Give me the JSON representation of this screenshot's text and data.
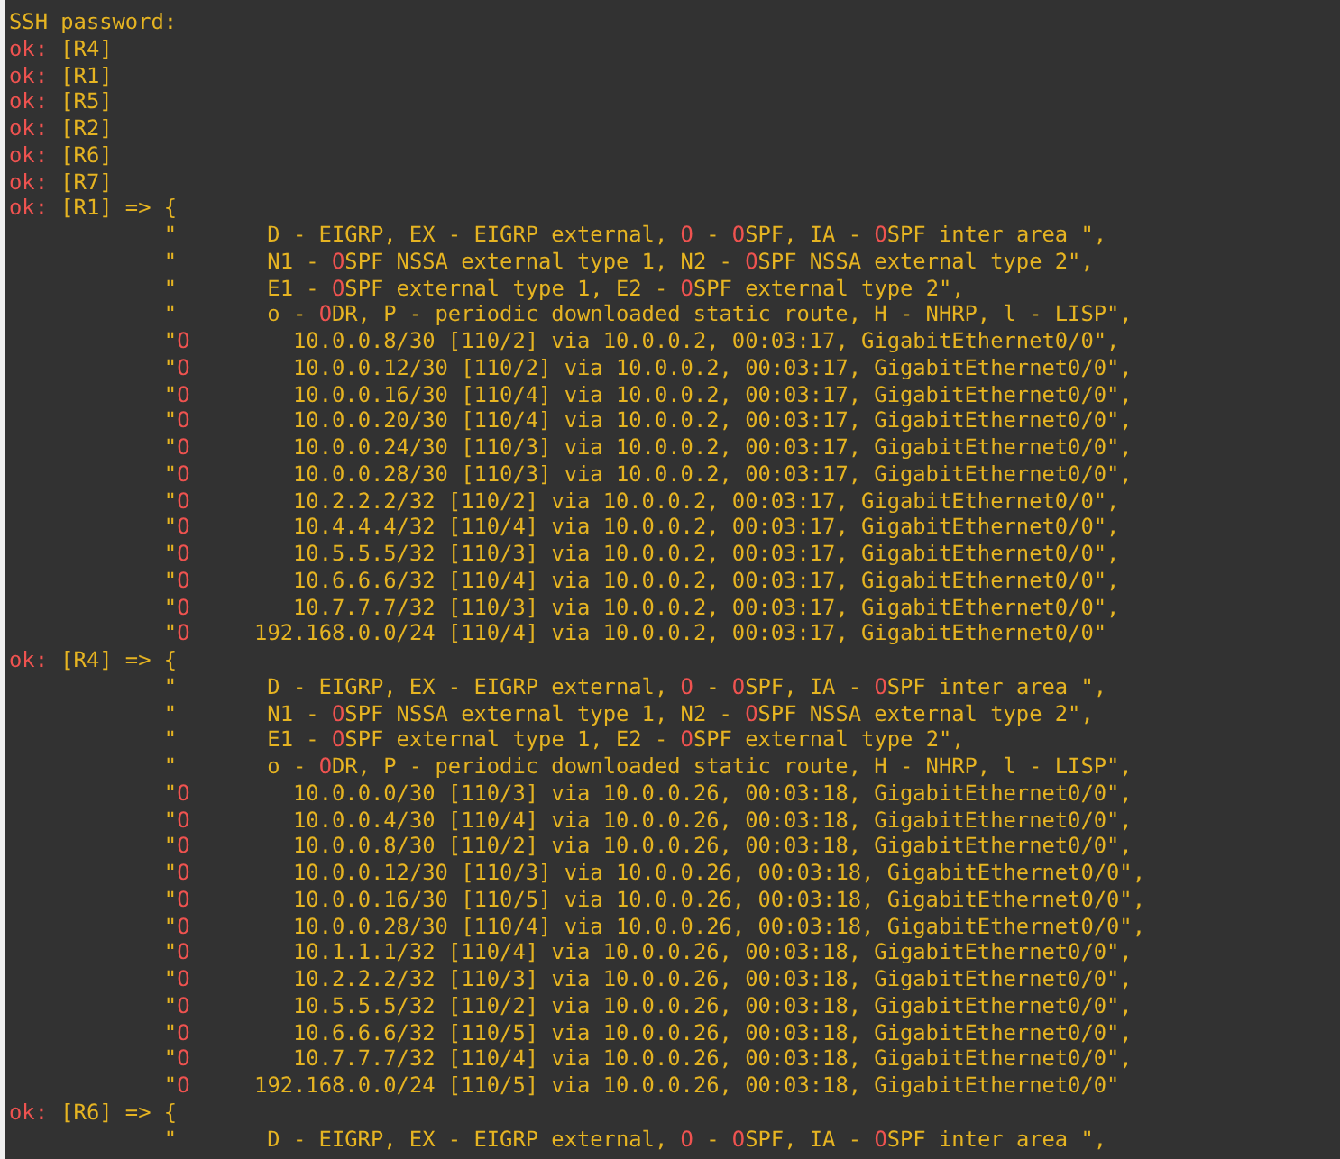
{
  "terminal": {
    "lines": [
      {
        "segments": [
          {
            "text": "SSH password:",
            "kind": "plain"
          }
        ]
      },
      {
        "segments": [
          {
            "text": "ok:",
            "kind": "highlight"
          },
          {
            "text": " [R4]",
            "kind": "plain"
          }
        ]
      },
      {
        "segments": [
          {
            "text": "ok:",
            "kind": "highlight"
          },
          {
            "text": " [R1]",
            "kind": "plain"
          }
        ]
      },
      {
        "segments": [
          {
            "text": "ok:",
            "kind": "highlight"
          },
          {
            "text": " [R5]",
            "kind": "plain"
          }
        ]
      },
      {
        "segments": [
          {
            "text": "ok:",
            "kind": "highlight"
          },
          {
            "text": " [R2]",
            "kind": "plain"
          }
        ]
      },
      {
        "segments": [
          {
            "text": "ok:",
            "kind": "highlight"
          },
          {
            "text": " [R6]",
            "kind": "plain"
          }
        ]
      },
      {
        "segments": [
          {
            "text": "ok:",
            "kind": "highlight"
          },
          {
            "text": " [R7]",
            "kind": "plain"
          }
        ]
      },
      {
        "segments": [
          {
            "text": "ok:",
            "kind": "highlight"
          },
          {
            "text": " [R1] => {",
            "kind": "plain"
          }
        ]
      },
      {
        "segments": [
          {
            "text": "            \"       D - EIGRP, EX - EIGRP external, ",
            "kind": "plain"
          },
          {
            "text": "O",
            "kind": "highlight"
          },
          {
            "text": " - ",
            "kind": "plain"
          },
          {
            "text": "O",
            "kind": "highlight"
          },
          {
            "text": "SPF, IA - ",
            "kind": "plain"
          },
          {
            "text": "O",
            "kind": "highlight"
          },
          {
            "text": "SPF inter area \",",
            "kind": "plain"
          }
        ]
      },
      {
        "segments": [
          {
            "text": "            \"       N1 - ",
            "kind": "plain"
          },
          {
            "text": "O",
            "kind": "highlight"
          },
          {
            "text": "SPF NSSA external type 1, N2 - ",
            "kind": "plain"
          },
          {
            "text": "O",
            "kind": "highlight"
          },
          {
            "text": "SPF NSSA external type 2\",",
            "kind": "plain"
          }
        ]
      },
      {
        "segments": [
          {
            "text": "            \"       E1 - ",
            "kind": "plain"
          },
          {
            "text": "O",
            "kind": "highlight"
          },
          {
            "text": "SPF external type 1, E2 - ",
            "kind": "plain"
          },
          {
            "text": "O",
            "kind": "highlight"
          },
          {
            "text": "SPF external type 2\",",
            "kind": "plain"
          }
        ]
      },
      {
        "segments": [
          {
            "text": "            \"       o - ",
            "kind": "plain"
          },
          {
            "text": "O",
            "kind": "highlight"
          },
          {
            "text": "DR, P - periodic downloaded static route, H - NHRP, l - LISP\",",
            "kind": "plain"
          }
        ]
      },
      {
        "segments": [
          {
            "text": "            \"",
            "kind": "plain"
          },
          {
            "text": "O",
            "kind": "highlight"
          },
          {
            "text": "        10.0.0.8/30 [110/2] via 10.0.0.2, 00:03:17, GigabitEthernet0/0\",",
            "kind": "plain"
          }
        ]
      },
      {
        "segments": [
          {
            "text": "            \"",
            "kind": "plain"
          },
          {
            "text": "O",
            "kind": "highlight"
          },
          {
            "text": "        10.0.0.12/30 [110/2] via 10.0.0.2, 00:03:17, GigabitEthernet0/0\",",
            "kind": "plain"
          }
        ]
      },
      {
        "segments": [
          {
            "text": "            \"",
            "kind": "plain"
          },
          {
            "text": "O",
            "kind": "highlight"
          },
          {
            "text": "        10.0.0.16/30 [110/4] via 10.0.0.2, 00:03:17, GigabitEthernet0/0\",",
            "kind": "plain"
          }
        ]
      },
      {
        "segments": [
          {
            "text": "            \"",
            "kind": "plain"
          },
          {
            "text": "O",
            "kind": "highlight"
          },
          {
            "text": "        10.0.0.20/30 [110/4] via 10.0.0.2, 00:03:17, GigabitEthernet0/0\",",
            "kind": "plain"
          }
        ]
      },
      {
        "segments": [
          {
            "text": "            \"",
            "kind": "plain"
          },
          {
            "text": "O",
            "kind": "highlight"
          },
          {
            "text": "        10.0.0.24/30 [110/3] via 10.0.0.2, 00:03:17, GigabitEthernet0/0\",",
            "kind": "plain"
          }
        ]
      },
      {
        "segments": [
          {
            "text": "            \"",
            "kind": "plain"
          },
          {
            "text": "O",
            "kind": "highlight"
          },
          {
            "text": "        10.0.0.28/30 [110/3] via 10.0.0.2, 00:03:17, GigabitEthernet0/0\",",
            "kind": "plain"
          }
        ]
      },
      {
        "segments": [
          {
            "text": "            \"",
            "kind": "plain"
          },
          {
            "text": "O",
            "kind": "highlight"
          },
          {
            "text": "        10.2.2.2/32 [110/2] via 10.0.0.2, 00:03:17, GigabitEthernet0/0\",",
            "kind": "plain"
          }
        ]
      },
      {
        "segments": [
          {
            "text": "            \"",
            "kind": "plain"
          },
          {
            "text": "O",
            "kind": "highlight"
          },
          {
            "text": "        10.4.4.4/32 [110/4] via 10.0.0.2, 00:03:17, GigabitEthernet0/0\",",
            "kind": "plain"
          }
        ]
      },
      {
        "segments": [
          {
            "text": "            \"",
            "kind": "plain"
          },
          {
            "text": "O",
            "kind": "highlight"
          },
          {
            "text": "        10.5.5.5/32 [110/3] via 10.0.0.2, 00:03:17, GigabitEthernet0/0\",",
            "kind": "plain"
          }
        ]
      },
      {
        "segments": [
          {
            "text": "            \"",
            "kind": "plain"
          },
          {
            "text": "O",
            "kind": "highlight"
          },
          {
            "text": "        10.6.6.6/32 [110/4] via 10.0.0.2, 00:03:17, GigabitEthernet0/0\",",
            "kind": "plain"
          }
        ]
      },
      {
        "segments": [
          {
            "text": "            \"",
            "kind": "plain"
          },
          {
            "text": "O",
            "kind": "highlight"
          },
          {
            "text": "        10.7.7.7/32 [110/3] via 10.0.0.2, 00:03:17, GigabitEthernet0/0\",",
            "kind": "plain"
          }
        ]
      },
      {
        "segments": [
          {
            "text": "            \"",
            "kind": "plain"
          },
          {
            "text": "O",
            "kind": "highlight"
          },
          {
            "text": "     192.168.0.0/24 [110/4] via 10.0.0.2, 00:03:17, GigabitEthernet0/0\"",
            "kind": "plain"
          }
        ]
      },
      {
        "segments": [
          {
            "text": "ok:",
            "kind": "highlight"
          },
          {
            "text": " [R4] => {",
            "kind": "plain"
          }
        ]
      },
      {
        "segments": [
          {
            "text": "            \"       D - EIGRP, EX - EIGRP external, ",
            "kind": "plain"
          },
          {
            "text": "O",
            "kind": "highlight"
          },
          {
            "text": " - ",
            "kind": "plain"
          },
          {
            "text": "O",
            "kind": "highlight"
          },
          {
            "text": "SPF, IA - ",
            "kind": "plain"
          },
          {
            "text": "O",
            "kind": "highlight"
          },
          {
            "text": "SPF inter area \",",
            "kind": "plain"
          }
        ]
      },
      {
        "segments": [
          {
            "text": "            \"       N1 - ",
            "kind": "plain"
          },
          {
            "text": "O",
            "kind": "highlight"
          },
          {
            "text": "SPF NSSA external type 1, N2 - ",
            "kind": "plain"
          },
          {
            "text": "O",
            "kind": "highlight"
          },
          {
            "text": "SPF NSSA external type 2\",",
            "kind": "plain"
          }
        ]
      },
      {
        "segments": [
          {
            "text": "            \"       E1 - ",
            "kind": "plain"
          },
          {
            "text": "O",
            "kind": "highlight"
          },
          {
            "text": "SPF external type 1, E2 - ",
            "kind": "plain"
          },
          {
            "text": "O",
            "kind": "highlight"
          },
          {
            "text": "SPF external type 2\",",
            "kind": "plain"
          }
        ]
      },
      {
        "segments": [
          {
            "text": "            \"       o - ",
            "kind": "plain"
          },
          {
            "text": "O",
            "kind": "highlight"
          },
          {
            "text": "DR, P - periodic downloaded static route, H - NHRP, l - LISP\",",
            "kind": "plain"
          }
        ]
      },
      {
        "segments": [
          {
            "text": "            \"",
            "kind": "plain"
          },
          {
            "text": "O",
            "kind": "highlight"
          },
          {
            "text": "        10.0.0.0/30 [110/3] via 10.0.0.26, 00:03:18, GigabitEthernet0/0\",",
            "kind": "plain"
          }
        ]
      },
      {
        "segments": [
          {
            "text": "            \"",
            "kind": "plain"
          },
          {
            "text": "O",
            "kind": "highlight"
          },
          {
            "text": "        10.0.0.4/30 [110/4] via 10.0.0.26, 00:03:18, GigabitEthernet0/0\",",
            "kind": "plain"
          }
        ]
      },
      {
        "segments": [
          {
            "text": "            \"",
            "kind": "plain"
          },
          {
            "text": "O",
            "kind": "highlight"
          },
          {
            "text": "        10.0.0.8/30 [110/2] via 10.0.0.26, 00:03:18, GigabitEthernet0/0\",",
            "kind": "plain"
          }
        ]
      },
      {
        "segments": [
          {
            "text": "            \"",
            "kind": "plain"
          },
          {
            "text": "O",
            "kind": "highlight"
          },
          {
            "text": "        10.0.0.12/30 [110/3] via 10.0.0.26, 00:03:18, GigabitEthernet0/0\",",
            "kind": "plain"
          }
        ]
      },
      {
        "segments": [
          {
            "text": "            \"",
            "kind": "plain"
          },
          {
            "text": "O",
            "kind": "highlight"
          },
          {
            "text": "        10.0.0.16/30 [110/5] via 10.0.0.26, 00:03:18, GigabitEthernet0/0\",",
            "kind": "plain"
          }
        ]
      },
      {
        "segments": [
          {
            "text": "            \"",
            "kind": "plain"
          },
          {
            "text": "O",
            "kind": "highlight"
          },
          {
            "text": "        10.0.0.28/30 [110/4] via 10.0.0.26, 00:03:18, GigabitEthernet0/0\",",
            "kind": "plain"
          }
        ]
      },
      {
        "segments": [
          {
            "text": "            \"",
            "kind": "plain"
          },
          {
            "text": "O",
            "kind": "highlight"
          },
          {
            "text": "        10.1.1.1/32 [110/4] via 10.0.0.26, 00:03:18, GigabitEthernet0/0\",",
            "kind": "plain"
          }
        ]
      },
      {
        "segments": [
          {
            "text": "            \"",
            "kind": "plain"
          },
          {
            "text": "O",
            "kind": "highlight"
          },
          {
            "text": "        10.2.2.2/32 [110/3] via 10.0.0.26, 00:03:18, GigabitEthernet0/0\",",
            "kind": "plain"
          }
        ]
      },
      {
        "segments": [
          {
            "text": "            \"",
            "kind": "plain"
          },
          {
            "text": "O",
            "kind": "highlight"
          },
          {
            "text": "        10.5.5.5/32 [110/2] via 10.0.0.26, 00:03:18, GigabitEthernet0/0\",",
            "kind": "plain"
          }
        ]
      },
      {
        "segments": [
          {
            "text": "            \"",
            "kind": "plain"
          },
          {
            "text": "O",
            "kind": "highlight"
          },
          {
            "text": "        10.6.6.6/32 [110/5] via 10.0.0.26, 00:03:18, GigabitEthernet0/0\",",
            "kind": "plain"
          }
        ]
      },
      {
        "segments": [
          {
            "text": "            \"",
            "kind": "plain"
          },
          {
            "text": "O",
            "kind": "highlight"
          },
          {
            "text": "        10.7.7.7/32 [110/4] via 10.0.0.26, 00:03:18, GigabitEthernet0/0\",",
            "kind": "plain"
          }
        ]
      },
      {
        "segments": [
          {
            "text": "            \"",
            "kind": "plain"
          },
          {
            "text": "O",
            "kind": "highlight"
          },
          {
            "text": "     192.168.0.0/24 [110/5] via 10.0.0.26, 00:03:18, GigabitEthernet0/0\"",
            "kind": "plain"
          }
        ]
      },
      {
        "segments": [
          {
            "text": "ok:",
            "kind": "highlight"
          },
          {
            "text": " [R6] => {",
            "kind": "plain"
          }
        ]
      },
      {
        "segments": [
          {
            "text": "            \"       D - EIGRP, EX - EIGRP external, ",
            "kind": "plain"
          },
          {
            "text": "O",
            "kind": "highlight"
          },
          {
            "text": " - ",
            "kind": "plain"
          },
          {
            "text": "O",
            "kind": "highlight"
          },
          {
            "text": "SPF, IA - ",
            "kind": "plain"
          },
          {
            "text": "O",
            "kind": "highlight"
          },
          {
            "text": "SPF inter area \",",
            "kind": "plain"
          }
        ]
      }
    ]
  }
}
